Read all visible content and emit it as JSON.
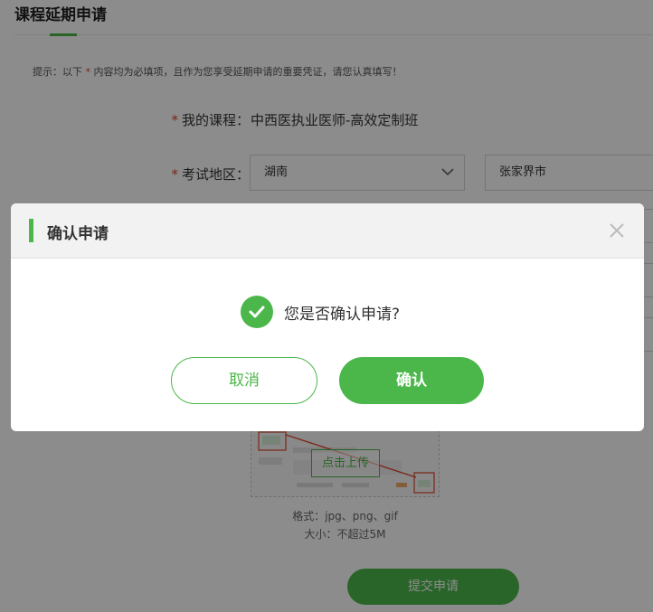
{
  "page": {
    "title": "课程延期申请",
    "hint_prefix": "提示：以下",
    "hint_star": "*",
    "hint_suffix": "内容均为必填项，且作为您享受延期申请的重要凭证，请您认真填写！"
  },
  "form": {
    "course_label": "我的课程：",
    "course_value": "中西医执业医师-高效定制班",
    "region_label": "考试地区：",
    "province": "湖南",
    "city": "张家界市",
    "required_mark": "*"
  },
  "upload": {
    "button_label": "点击上传",
    "format_text": "格式：jpg、png、gif",
    "size_text": "大小：不超过5M"
  },
  "submit_label": "提交申请",
  "modal": {
    "title": "确认申请",
    "message": "您是否确认申请?",
    "cancel_label": "取消",
    "confirm_label": "确认"
  },
  "colors": {
    "accent": "#4bb74a",
    "required": "#e0452b"
  },
  "icons": {
    "close": "close-icon",
    "check": "check-circle-icon",
    "dropdown": "chevron-down-icon"
  }
}
